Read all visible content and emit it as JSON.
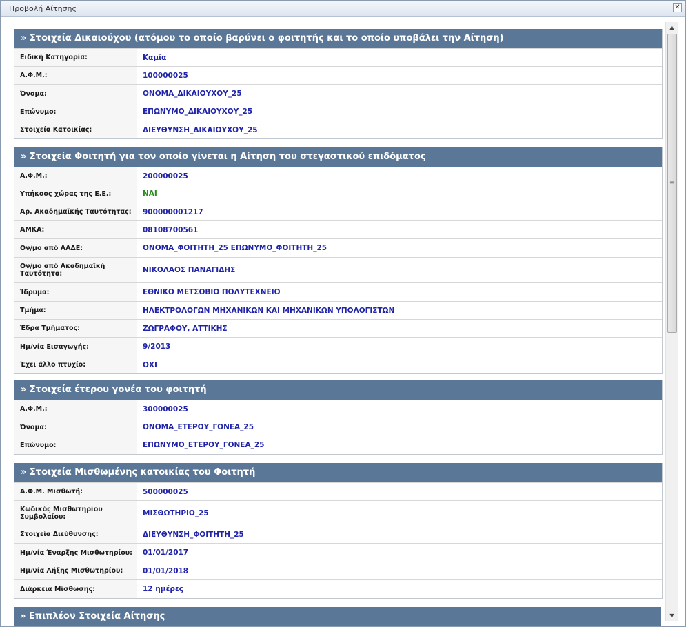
{
  "window": {
    "title": "Προβολή Αίτησης",
    "close_icon": "✕"
  },
  "sections": [
    {
      "title": "» Στοιχεία Δικαιούχου (ατόμου το οποίο βαρύνει ο φοιτητής και το οποίο υποβάλει την Αίτηση)",
      "rows": [
        {
          "label": "Ειδική Κατηγορία:",
          "value": "Καμία"
        },
        {
          "label": "Α.Φ.Μ.:",
          "value": "100000025"
        },
        {
          "label": "Όνομα:",
          "value": "ΟΝΟΜΑ_ΔΙΚΑΙΟΥΧΟΥ_25"
        },
        {
          "label": "Επώνυμο:",
          "value": "ΕΠΩΝΥΜΟ_ΔΙΚΑΙΟΥΧΟΥ_25"
        },
        {
          "label": "Στοιχεία Κατοικίας:",
          "value": "ΔΙΕΥΘΥΝΣΗ_ΔΙΚΑΙΟΥΧΟΥ_25"
        }
      ]
    },
    {
      "title": "» Στοιχεία Φοιτητή για τον οποίο γίνεται η Αίτηση του στεγαστικού επιδόματος",
      "rows": [
        {
          "label": "Α.Φ.Μ.:",
          "value": "200000025"
        },
        {
          "label": "Υπήκοος χώρας της Ε.Ε.:",
          "value": "ΝΑΙ"
        },
        {
          "label": "Αρ. Ακαδημαϊκής Ταυτότητας:",
          "value": "900000001217"
        },
        {
          "label": "ΑΜΚΑ:",
          "value": "08108700561"
        },
        {
          "label": "Ον/μο από ΑΑΔΕ:",
          "value": "ΟΝΟΜΑ_ΦΟΙΤΗΤΗ_25 ΕΠΩΝΥΜΟ_ΦΟΙΤΗΤΗ_25"
        },
        {
          "label": "Ον/μο από Ακαδημαϊκή Ταυτότητα:",
          "value": "ΝΙΚΟΛΑΟΣ ΠΑΝΑΓΙΔΗΣ"
        },
        {
          "label": "Ίδρυμα:",
          "value": "ΕΘΝΙΚΟ ΜΕΤΣΟΒΙΟ ΠΟΛΥΤΕΧΝΕΙΟ"
        },
        {
          "label": "Τμήμα:",
          "value": "ΗΛΕΚΤΡΟΛΟΓΩΝ ΜΗΧΑΝΙΚΩΝ ΚΑΙ ΜΗΧΑΝΙΚΩΝ ΥΠΟΛΟΓΙΣΤΩΝ"
        },
        {
          "label": "Έδρα Τμήματος:",
          "value": "ΖΩΓΡΑΦΟΥ, ΑΤΤΙΚΗΣ"
        },
        {
          "label": "Ημ/νία Εισαγωγής:",
          "value": "9/2013"
        },
        {
          "label": "Έχει άλλο πτυχίο:",
          "value": "ΟΧΙ"
        }
      ]
    },
    {
      "title": "» Στοιχεία έτερου γονέα του φοιτητή",
      "rows": [
        {
          "label": "Α.Φ.Μ.:",
          "value": "300000025"
        },
        {
          "label": "Όνομα:",
          "value": "ΟΝΟΜΑ_ΕΤΕΡΟΥ_ΓΟΝΕΑ_25"
        },
        {
          "label": "Επώνυμο:",
          "value": "ΕΠΩΝΥΜΟ_ΕΤΕΡΟΥ_ΓΟΝΕΑ_25"
        }
      ]
    },
    {
      "title": "» Στοιχεία Μισθωμένης κατοικίας του Φοιτητή",
      "rows": [
        {
          "label": "Α.Φ.Μ. Μισθωτή:",
          "value": "500000025"
        },
        {
          "label": "Κωδικός Μισθωτηρίου Συμβολαίου:",
          "value": "ΜΙΣΘΩΤΗΡΙΟ_25"
        },
        {
          "label": "Στοιχεία Διεύθυνσης:",
          "value": "ΔΙΕΥΘΥΝΣΗ_ΦΟΙΤΗΤΗ_25"
        },
        {
          "label": "Ημ/νία Έναρξης Μισθωτηρίου:",
          "value": "01/01/2017"
        },
        {
          "label": "Ημ/νία Λήξης Μισθωτηρίου:",
          "value": "01/01/2018"
        },
        {
          "label": "Διάρκεια Μίσθωσης:",
          "value": "12 ημέρες"
        }
      ]
    },
    {
      "title": "» Επιπλέον Στοιχεία Αίτησης",
      "rows": []
    }
  ],
  "scrollbar": {
    "up_icon": "▲",
    "down_icon": "▼",
    "grip_icon": "≡"
  }
}
